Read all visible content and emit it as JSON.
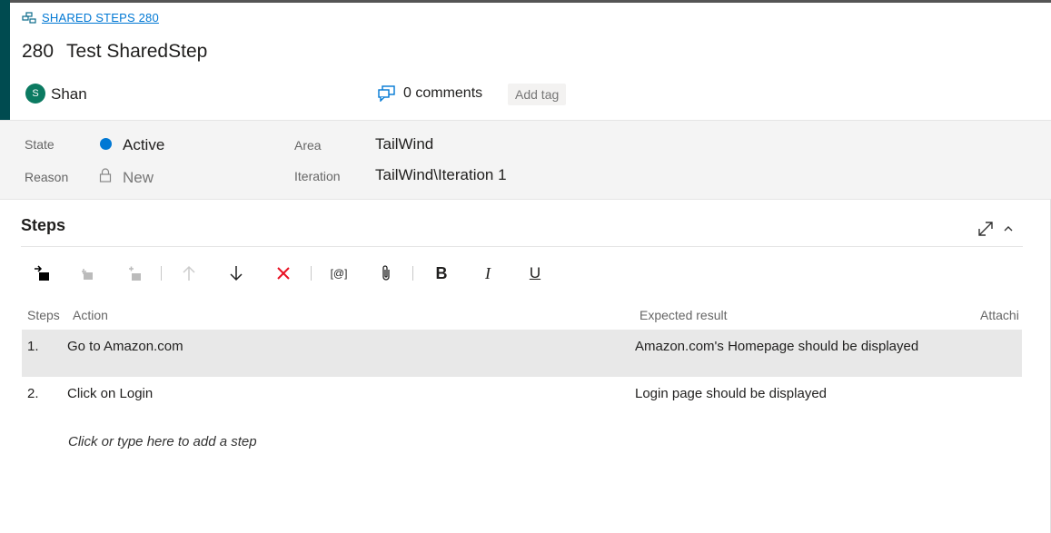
{
  "work_item": {
    "type_link": "SHARED STEPS 280",
    "id": "280",
    "title": "Test SharedStep",
    "author_initial": "S",
    "author": "Shan",
    "comments": "0 comments",
    "add_tag": "Add tag"
  },
  "fields": {
    "state_label": "State",
    "state_value": "Active",
    "reason_label": "Reason",
    "reason_value": "New",
    "area_label": "Area",
    "area_value": "TailWind",
    "iteration_label": "Iteration",
    "iteration_value": "TailWind\\Iteration 1"
  },
  "steps_section": {
    "title": "Steps",
    "toolbar": {
      "parameter_label": "[@]",
      "bold_label": "B",
      "italic_label": "I",
      "underline_label": "U"
    },
    "columns": {
      "steps": "Steps",
      "action": "Action",
      "expected": "Expected result",
      "attachments": "Attachi"
    },
    "rows": [
      {
        "num": "1.",
        "action": "Go to Amazon.com",
        "expected": "Amazon.com's Homepage should be displayed"
      },
      {
        "num": "2.",
        "action": "Click on Login",
        "expected": "Login page should be displayed"
      }
    ],
    "add_step_placeholder": "Click or type here to add a step"
  },
  "colors": {
    "accent": "#0078d4",
    "left_bar": "#004b50",
    "avatar": "#0b7a61",
    "delete": "#e81123"
  }
}
